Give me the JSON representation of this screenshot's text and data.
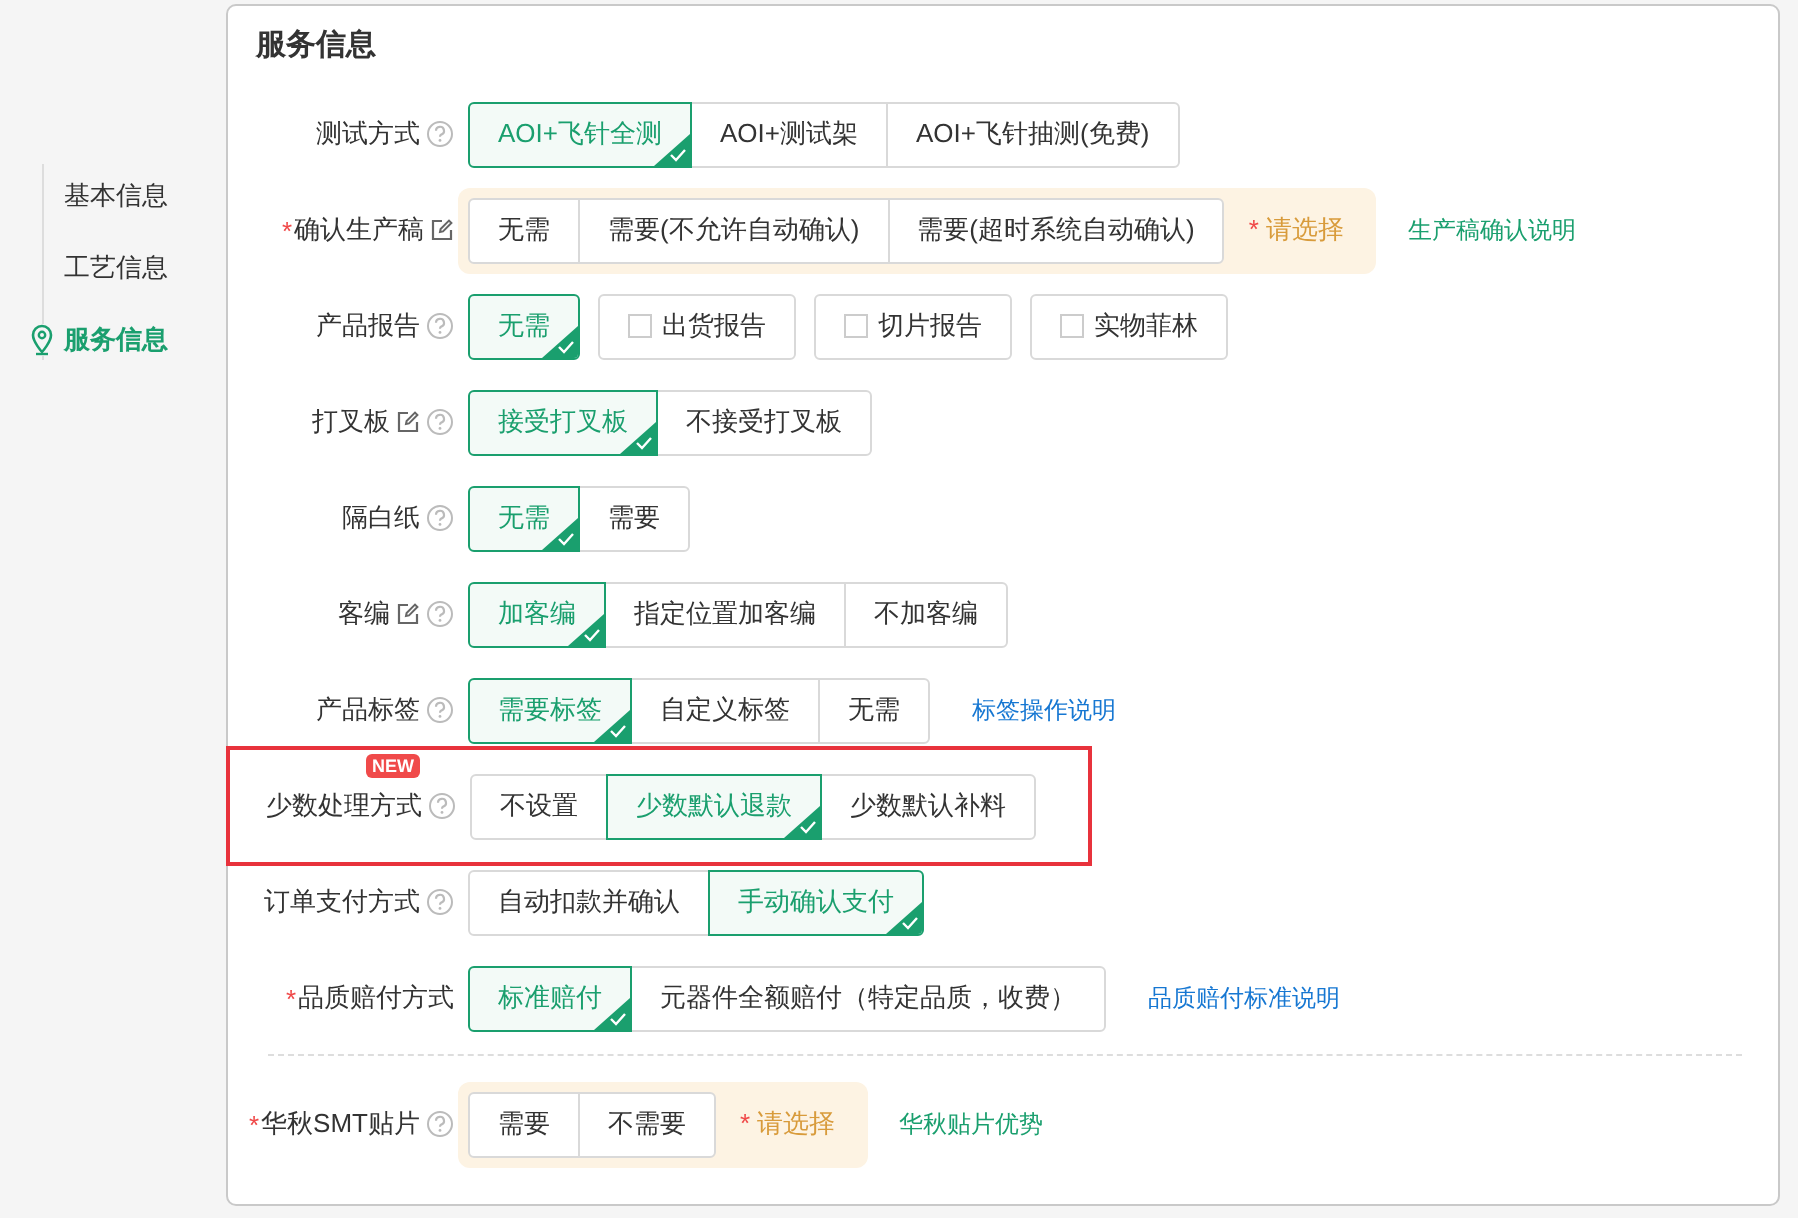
{
  "nav": [
    {
      "label": "基本信息",
      "selected": false
    },
    {
      "label": "工艺信息",
      "selected": false
    },
    {
      "label": "服务信息",
      "selected": true
    }
  ],
  "section": {
    "title": "服务信息"
  },
  "rows": [
    {
      "label": "测试方式",
      "required": false,
      "edit": false,
      "help": true,
      "kind": "joined",
      "options": [
        {
          "label": "AOI+飞针全测",
          "selected": true
        },
        {
          "label": "AOI+测试架",
          "selected": false
        },
        {
          "label": "AOI+飞针抽测(免费)",
          "selected": false
        }
      ]
    },
    {
      "label": "确认生产稿",
      "required": true,
      "edit": true,
      "help": false,
      "kind": "joined",
      "warning": {
        "mark": "*",
        "text": "请选择"
      },
      "options": [
        {
          "label": "无需",
          "selected": false
        },
        {
          "label": "需要(不允许自动确认)",
          "selected": false
        },
        {
          "label": "需要(超时系统自动确认)",
          "selected": false
        }
      ],
      "link": {
        "text": "生产稿确认说明",
        "color": "#1a9f6e"
      }
    },
    {
      "label": "产品报告",
      "required": false,
      "edit": false,
      "help": true,
      "kind": "separate",
      "options": [
        {
          "label": "无需",
          "selected": true,
          "kind": "radio"
        },
        {
          "label": "出货报告",
          "checked": false,
          "kind": "checkbox"
        },
        {
          "label": "切片报告",
          "checked": false,
          "kind": "checkbox"
        },
        {
          "label": "实物菲林",
          "checked": false,
          "kind": "checkbox"
        }
      ]
    },
    {
      "label": "打叉板",
      "required": false,
      "edit": true,
      "help": true,
      "kind": "joined",
      "options": [
        {
          "label": "接受打叉板",
          "selected": true
        },
        {
          "label": "不接受打叉板",
          "selected": false
        }
      ]
    },
    {
      "label": "隔白纸",
      "required": false,
      "edit": false,
      "help": true,
      "kind": "joined",
      "options": [
        {
          "label": "无需",
          "selected": true
        },
        {
          "label": "需要",
          "selected": false
        }
      ]
    },
    {
      "label": "客编",
      "required": false,
      "edit": true,
      "help": true,
      "kind": "joined",
      "options": [
        {
          "label": "加客编",
          "selected": true
        },
        {
          "label": "指定位置加客编",
          "selected": false
        },
        {
          "label": "不加客编",
          "selected": false
        }
      ]
    },
    {
      "label": "产品标签",
      "required": false,
      "edit": false,
      "help": true,
      "kind": "joined",
      "options": [
        {
          "label": "需要标签",
          "selected": true
        },
        {
          "label": "自定义标签",
          "selected": false
        },
        {
          "label": "无需",
          "selected": false
        }
      ],
      "link": {
        "text": "标签操作说明",
        "color": "#1677d2"
      }
    },
    {
      "label": "少数处理方式",
      "required": false,
      "edit": false,
      "help": true,
      "kind": "joined",
      "badge": "NEW",
      "highlighted": true,
      "options": [
        {
          "label": "不设置",
          "selected": false
        },
        {
          "label": "少数默认退款",
          "selected": true
        },
        {
          "label": "少数默认补料",
          "selected": false
        }
      ]
    },
    {
      "label": "订单支付方式",
      "required": false,
      "edit": false,
      "help": true,
      "kind": "joined",
      "options": [
        {
          "label": "自动扣款并确认",
          "selected": false
        },
        {
          "label": "手动确认支付",
          "selected": true
        }
      ]
    },
    {
      "label": "品质赔付方式",
      "required": true,
      "edit": false,
      "help": false,
      "kind": "joined",
      "options": [
        {
          "label": "标准赔付",
          "selected": true
        },
        {
          "label": "元器件全额赔付（特定品质，收费）",
          "selected": false
        }
      ],
      "link": {
        "text": "品质赔付标准说明",
        "color": "#1677d2"
      }
    },
    {
      "kind": "divider"
    },
    {
      "label": "华秋SMT贴片",
      "required": true,
      "edit": false,
      "help": true,
      "kind": "joined",
      "warning": {
        "mark": "*",
        "text": "请选择"
      },
      "options": [
        {
          "label": "需要",
          "selected": false
        },
        {
          "label": "不需要",
          "selected": false
        }
      ],
      "link": {
        "text": "华秋贴片优势",
        "color": "#1a9f6e"
      }
    }
  ]
}
